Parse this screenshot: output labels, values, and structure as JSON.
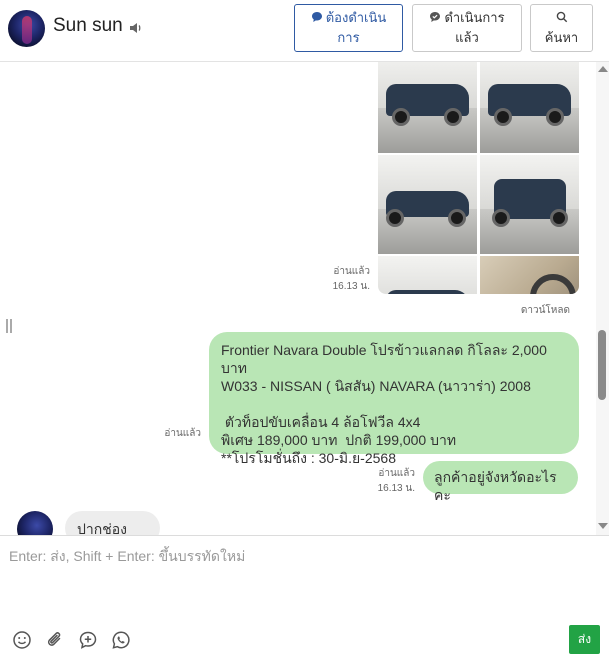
{
  "contact": {
    "name": "Sun sun"
  },
  "header_buttons": {
    "todo": {
      "line1": "ต้องดำเนิน",
      "line2": "การ"
    },
    "done": {
      "line1": "ดำเนินการ",
      "line2": "แล้ว"
    },
    "search": {
      "label": "ค้นหา"
    }
  },
  "messages": {
    "photos": {
      "read_status": "อ่านแล้ว",
      "time": "16.13 น.",
      "download_label": "ดาวน์โหลด"
    },
    "product": {
      "read_status": "อ่านแล้ว",
      "text": "Frontier Navara Double โปรข้าวแลกลด กิโลละ 2,000 บาท\nW033 - NISSAN ( นิสสัน) NAVARA (นาวาร่า) 2008\n\n ตัวท็อปขับเคลื่อน 4 ล้อโฟวีล 4x4\nพิเศษ 189,000 บาท  ปกติ 199,000 บาท\n**โปรโมชั่นถึง : 30-มิ.ย-2568"
    },
    "question": {
      "read_status": "อ่านแล้ว",
      "time": "16.13 น.",
      "text": "ลูกค้าอยู่จังหวัดอะไรคะ"
    },
    "incoming": {
      "text": "ปากช่องครับ"
    }
  },
  "composer": {
    "placeholder": "Enter: ส่ง, Shift + Enter: ขึ้นบรรทัดใหม่",
    "send_label": "ส่ง"
  },
  "colors": {
    "accent": "#2f5aa3",
    "bubble_out": "#b9e6b5",
    "bubble_in": "#ededed",
    "send": "#22a345"
  }
}
